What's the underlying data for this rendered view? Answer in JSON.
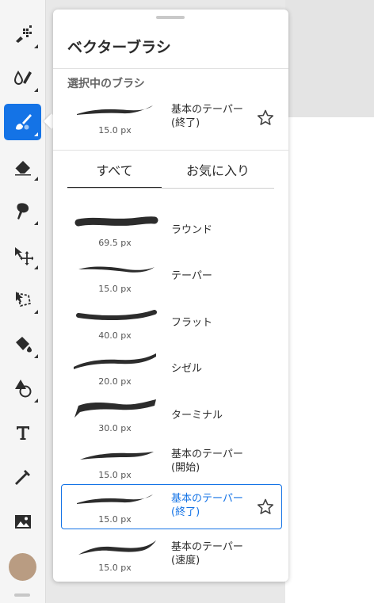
{
  "popover": {
    "title": "ベクターブラシ",
    "selected_section_label": "選択中のブラシ",
    "selected_brush": {
      "name": "基本のテーパー\n(終了)",
      "size": "15.0 px"
    },
    "tabs": [
      {
        "label": "すべて",
        "active": true
      },
      {
        "label": "お気に入り",
        "active": false
      }
    ],
    "brushes": [
      {
        "name": "ラウンド",
        "size": "69.5 px"
      },
      {
        "name": "テーパー",
        "size": "15.0 px"
      },
      {
        "name": "フラット",
        "size": "40.0 px"
      },
      {
        "name": "シゼル",
        "size": "20.0 px"
      },
      {
        "name": "ターミナル",
        "size": "30.0 px"
      },
      {
        "name": "基本のテーパー\n(開始)",
        "size": "15.0 px"
      },
      {
        "name": "基本のテーパー\n(終了)",
        "size": "15.0 px",
        "selected": true
      },
      {
        "name": "基本のテーパー\n(速度)",
        "size": "15.0 px"
      }
    ]
  },
  "toolbar": {
    "tools": [
      "pixel-brush-icon",
      "paint-brush-icon",
      "vector-brush-icon",
      "eraser-icon",
      "smudge-icon",
      "move-icon",
      "lasso-icon",
      "fill-icon",
      "shapes-icon",
      "text-icon",
      "eyedropper-icon",
      "image-icon"
    ],
    "active_tool": "vector-brush-icon",
    "current_color": "#b99c82"
  },
  "colors": {
    "accent": "#1473e6"
  }
}
